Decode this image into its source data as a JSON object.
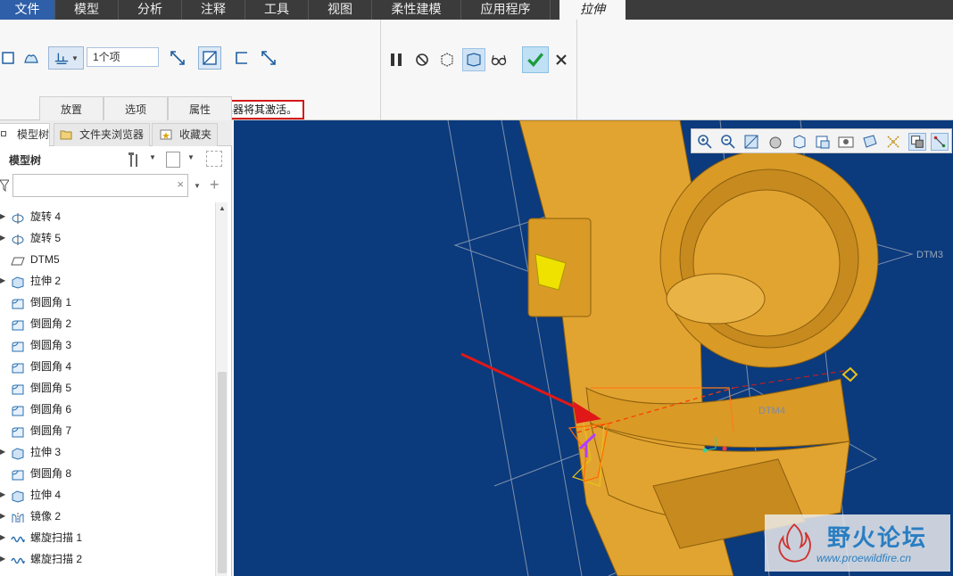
{
  "menu": {
    "file": "文件",
    "tabs": [
      "模型",
      "分析",
      "注释",
      "工具",
      "视图",
      "柔性建模",
      "应用程序"
    ],
    "active_tab": "拉伸"
  },
  "ribbon": {
    "depth_field_value": "1个项",
    "tooltip": "深度参考。单击收集器将其激活。",
    "subtabs": [
      "放置",
      "选项",
      "属性"
    ]
  },
  "panel": {
    "tabs": [
      "模型树",
      "文件夹浏览器",
      "收藏夹"
    ],
    "header": "模型树",
    "filter_placeholder": ""
  },
  "tree": [
    {
      "label": "旋转 4",
      "icon": "revolve-icon",
      "expandable": true
    },
    {
      "label": "旋转 5",
      "icon": "revolve-icon",
      "expandable": true
    },
    {
      "label": "DTM5",
      "icon": "datum-plane-icon",
      "expandable": false
    },
    {
      "label": "拉伸 2",
      "icon": "extrude-icon",
      "expandable": true
    },
    {
      "label": "倒圆角 1",
      "icon": "round-icon",
      "expandable": false
    },
    {
      "label": "倒圆角 2",
      "icon": "round-icon",
      "expandable": false
    },
    {
      "label": "倒圆角 3",
      "icon": "round-icon",
      "expandable": false
    },
    {
      "label": "倒圆角 4",
      "icon": "round-icon",
      "expandable": false
    },
    {
      "label": "倒圆角 5",
      "icon": "round-icon",
      "expandable": false
    },
    {
      "label": "倒圆角 6",
      "icon": "round-icon",
      "expandable": false
    },
    {
      "label": "倒圆角 7",
      "icon": "round-icon",
      "expandable": false
    },
    {
      "label": "拉伸 3",
      "icon": "extrude-icon",
      "expandable": true
    },
    {
      "label": "倒圆角 8",
      "icon": "round-icon",
      "expandable": false
    },
    {
      "label": "拉伸 4",
      "icon": "extrude-icon",
      "expandable": true
    },
    {
      "label": "镜像 2",
      "icon": "mirror-icon",
      "expandable": true
    },
    {
      "label": "螺旋扫描 1",
      "icon": "helical-sweep-icon",
      "expandable": true
    },
    {
      "label": "螺旋扫描 2",
      "icon": "helical-sweep-icon",
      "expandable": true
    }
  ],
  "viewport": {
    "datum_labels": [
      "DTM3",
      "DTM4"
    ],
    "watermark_title": "野火论坛",
    "watermark_url": "www.proewildfire.cn"
  },
  "colors": {
    "viewport_bg": "#0b3a7d",
    "part": "#e2a430",
    "file_tab": "#2e5fa8",
    "highlight": "#d21a1a"
  }
}
